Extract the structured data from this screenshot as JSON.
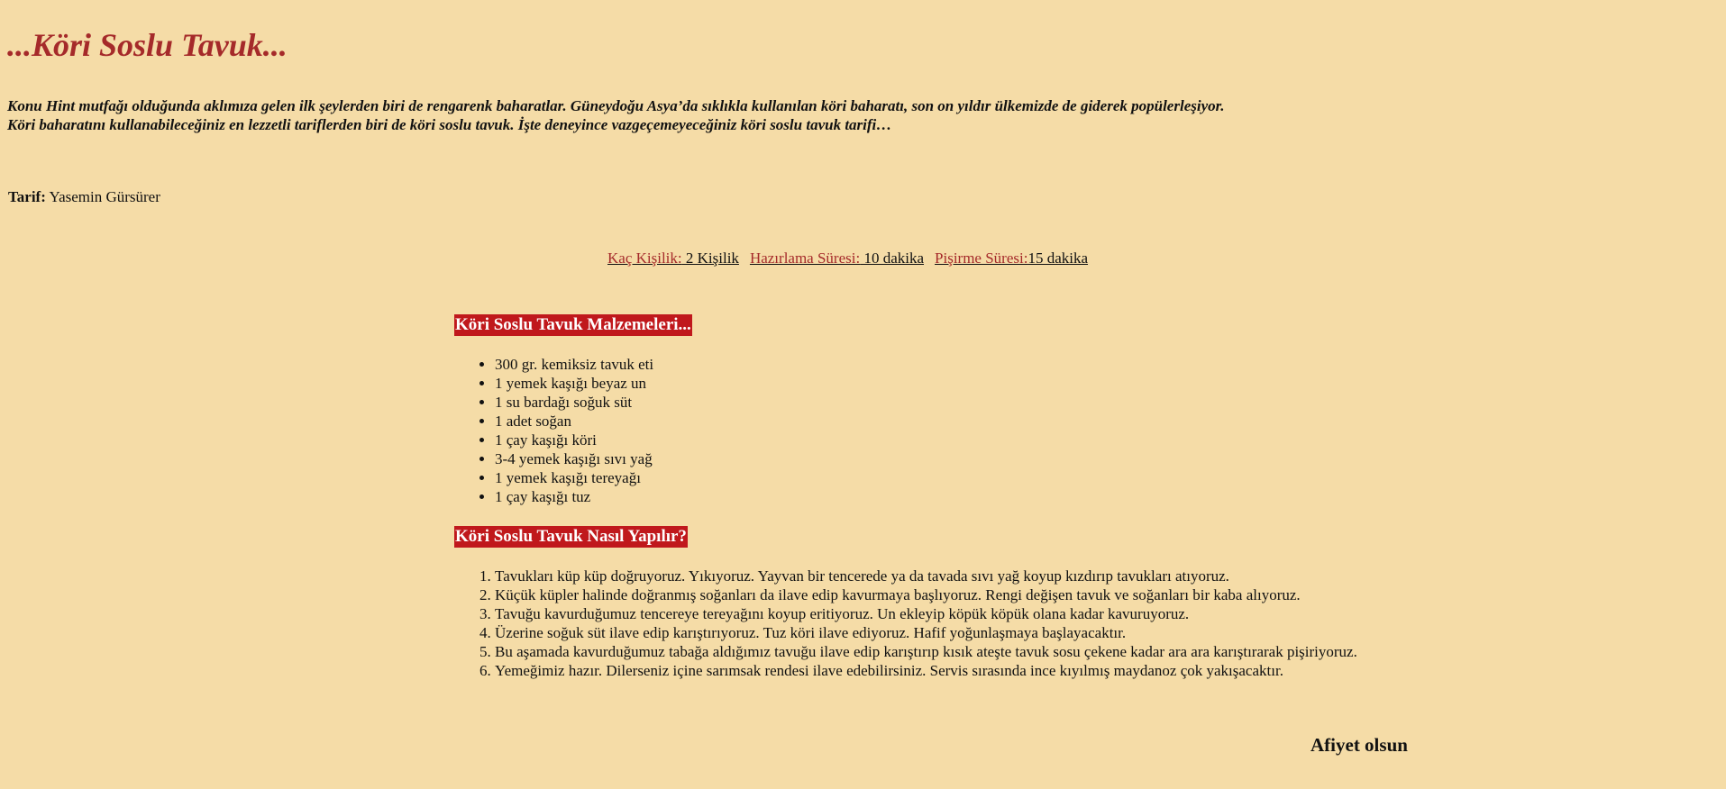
{
  "title": "...Köri Soslu Tavuk...",
  "intro": {
    "line1": "Konu Hint mutfağı olduğunda aklımıza gelen ilk şeylerden biri de rengarenk baharatlar. Güneydoğu Asya’da sıklıkla kullanılan köri baharatı, son on yıldır ülkemizde de giderek popülerleşiyor.",
    "line2": "Köri baharatını kullanabileceğiniz en lezzetli tariflerden biri de köri soslu tavuk. İşte deneyince vazgeçemeyeceğiniz köri soslu tavuk tarifi…"
  },
  "author": {
    "label": "Tarif:",
    "name": " Yasemin Gürsürer"
  },
  "meta": {
    "servings_label": "Kaç Kişilik:",
    "servings_value": " 2 Kişilik",
    "prep_label": "Hazırlama Süresi:",
    "prep_value": " 10 dakika",
    "cook_label": "Pişirme Süresi:",
    "cook_value": "15 dakika"
  },
  "ingredients": {
    "heading": "Köri Soslu Tavuk Malzemeleri...",
    "items": [
      "300 gr. kemiksiz tavuk eti",
      "1 yemek kaşığı beyaz un",
      "1 su bardağı soğuk süt",
      "1 adet soğan",
      "1 çay kaşığı köri",
      "3-4 yemek kaşığı sıvı yağ",
      "1 yemek kaşığı tereyağı",
      "1 çay kaşığı tuz"
    ]
  },
  "steps": {
    "heading": "Köri Soslu Tavuk Nasıl Yapılır?",
    "items": [
      "Tavukları küp küp doğruyoruz. Yıkıyoruz. Yayvan bir tencerede ya da tavada sıvı yağ koyup kızdırıp tavukları atıyoruz.",
      "Küçük küpler halinde doğranmış soğanları da ilave edip kavurmaya başlıyoruz. Rengi değişen tavuk ve soğanları bir kaba alıyoruz.",
      "Tavuğu kavurduğumuz tencereye tereyağını koyup eritiyoruz. Un ekleyip köpük köpük olana kadar kavuruyoruz.",
      "Üzerine soğuk süt ilave edip karıştırıyoruz. Tuz köri ilave ediyoruz. Hafif yoğunlaşmaya başlayacaktır.",
      "Bu aşamada kavurduğumuz tabağa aldığımız tavuğu ilave edip karıştırıp kısık ateşte tavuk sosu çekene kadar ara ara karıştırarak pişiriyoruz.",
      "Yemeğimiz hazır. Dilerseniz içine sarımsak rendesi ilave edebilirsiniz. Servis sırasında ince kıyılmış maydanoz çok yakışacaktır."
    ]
  },
  "closing": "Afiyet olsun"
}
